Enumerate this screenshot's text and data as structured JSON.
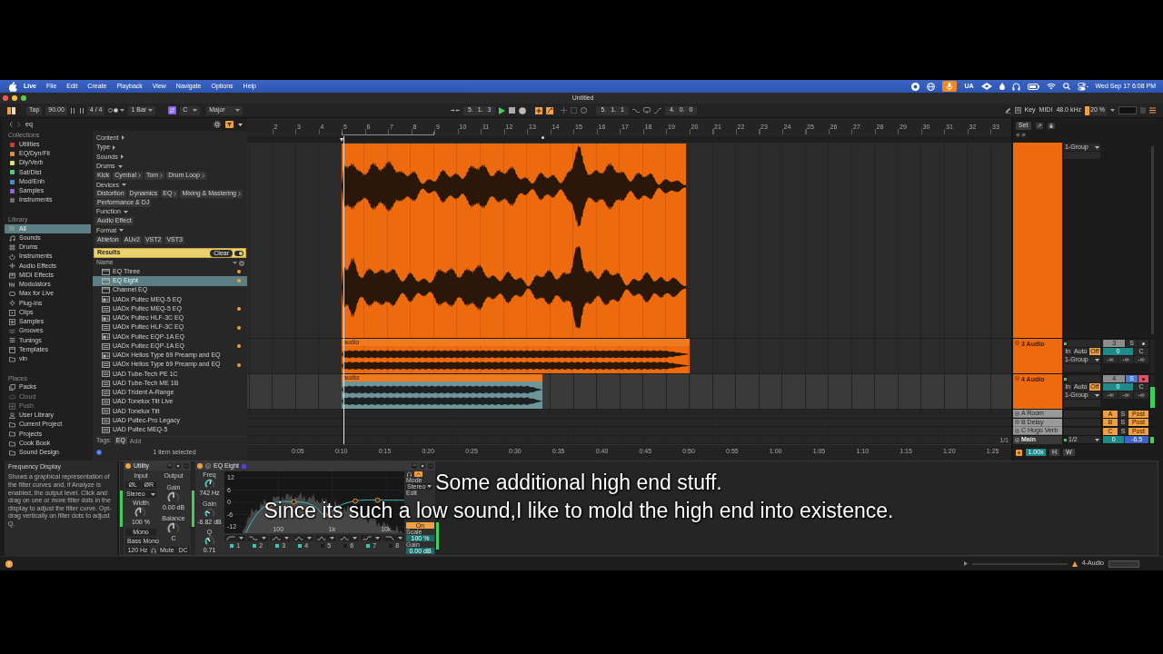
{
  "menu_bar": {
    "app": "Live",
    "items": [
      "File",
      "Edit",
      "Create",
      "Playback",
      "View",
      "Navigate",
      "Options",
      "Help"
    ],
    "status_label": "UA",
    "clock": "Wed Sep 17 6:08 PM"
  },
  "window": {
    "title": "Untitled"
  },
  "toolbar": {
    "tap": "Tap",
    "tempo": "90.00",
    "meter": "4 / 4",
    "quantize": "1 Bar",
    "key": "C",
    "scale": "Major",
    "position": "5. 1. 3",
    "loop_start": "5. 1. 1",
    "loop_length": "4. 0. 0",
    "key_button": "Key",
    "midi_button": "MIDI",
    "sample_rate": "48.0 kHz",
    "cpu": {
      "reading": "20 %",
      "level": 0.2
    }
  },
  "browser": {
    "search": "eq",
    "collections_heading": "Collections",
    "collections": [
      {
        "label": "Utilities",
        "color": "#d63a2f"
      },
      {
        "label": "EQ/Dyn/Fil",
        "color": "#e98a2a"
      },
      {
        "label": "Dly/Verb",
        "color": "#e8e06a"
      },
      {
        "label": "Sat/Dist",
        "color": "#4fd27c"
      },
      {
        "label": "Mod/Enh",
        "color": "#3f8de0"
      },
      {
        "label": "Samples",
        "color": "#9a5be0"
      },
      {
        "label": "Instruments",
        "color": "#6f6f6f"
      }
    ],
    "library_heading": "Library",
    "library": [
      {
        "label": "All",
        "selected": true
      },
      {
        "label": "Sounds",
        "selected": false
      },
      {
        "label": "Drums",
        "selected": false
      },
      {
        "label": "Instruments",
        "selected": false
      },
      {
        "label": "Audio Effects",
        "selected": false
      },
      {
        "label": "MIDI Effects",
        "selected": false
      },
      {
        "label": "Modulators",
        "selected": false
      },
      {
        "label": "Max for Live",
        "selected": false
      },
      {
        "label": "Plug-ins",
        "selected": false
      },
      {
        "label": "Clips",
        "selected": false
      },
      {
        "label": "Samples",
        "selected": false
      },
      {
        "label": "Grooves",
        "selected": false
      },
      {
        "label": "Tunings",
        "selected": false
      },
      {
        "label": "Templates",
        "selected": false
      },
      {
        "label": "vin",
        "selected": false
      }
    ],
    "places_heading": "Places",
    "places": [
      {
        "label": "Packs",
        "disabled": false
      },
      {
        "label": "Cloud",
        "disabled": true
      },
      {
        "label": "Push",
        "disabled": true
      },
      {
        "label": "User Library",
        "disabled": false
      },
      {
        "label": "Current Project",
        "disabled": false
      },
      {
        "label": "Projects",
        "disabled": false
      },
      {
        "label": "Cook Book",
        "disabled": false
      },
      {
        "label": "Sound Design",
        "disabled": false
      }
    ],
    "filters": [
      {
        "label": "Content",
        "expanded": false
      },
      {
        "label": "Type",
        "expanded": false
      },
      {
        "label": "Sounds",
        "expanded": false
      },
      {
        "label": "Drums",
        "expanded": true,
        "tags": [
          {
            "label": "Kick",
            "more": false
          },
          {
            "label": "Cymbal",
            "more": true
          },
          {
            "label": "Tom",
            "more": true
          },
          {
            "label": "Drum Loop",
            "more": true
          }
        ]
      },
      {
        "label": "Devices",
        "expanded": true,
        "tags": [
          {
            "label": "Distortion",
            "more": false
          },
          {
            "label": "Dynamics",
            "more": false
          },
          {
            "label": "EQ",
            "more": true
          },
          {
            "label": "Mixing & Mastering",
            "more": true
          },
          {
            "label": "Performance & DJ",
            "more": false
          }
        ]
      },
      {
        "label": "Function",
        "expanded": true,
        "tags": [
          {
            "label": "Audio Effect",
            "more": false
          }
        ]
      },
      {
        "label": "Format",
        "expanded": true,
        "tags": [
          {
            "label": "Ableton",
            "more": false
          },
          {
            "label": "AUv2",
            "more": false
          },
          {
            "label": "VST2",
            "more": false
          },
          {
            "label": "VST3",
            "more": false
          }
        ]
      }
    ],
    "results": {
      "heading": "Results",
      "clear": "Clear",
      "column": "Name",
      "items": [
        {
          "label": "EQ Three",
          "kind": "device",
          "favorite": true,
          "selected": false
        },
        {
          "label": "EQ Eight",
          "kind": "device",
          "favorite": true,
          "selected": true
        },
        {
          "label": "Channel EQ",
          "kind": "device",
          "favorite": false,
          "selected": false
        },
        {
          "label": "UADx Pultec MEQ-5 EQ",
          "kind": "wrapper",
          "favorite": false,
          "selected": false
        },
        {
          "label": "UADx Pultec MEQ-5 EQ",
          "kind": "plugin",
          "favorite": true,
          "selected": false
        },
        {
          "label": "UADx Pultec HLF-3C EQ",
          "kind": "wrapper",
          "favorite": false,
          "selected": false
        },
        {
          "label": "UADx Pultec HLF-3C EQ",
          "kind": "plugin",
          "favorite": true,
          "selected": false
        },
        {
          "label": "UADx Pultec EQP-1A EQ",
          "kind": "wrapper",
          "favorite": false,
          "selected": false
        },
        {
          "label": "UADx Pultec EQP-1A EQ",
          "kind": "plugin",
          "favorite": true,
          "selected": false
        },
        {
          "label": "UADx Helios Type 69 Preamp and EQ",
          "kind": "wrapper",
          "favorite": false,
          "selected": false
        },
        {
          "label": "UADx Helios Type 69 Preamp and EQ",
          "kind": "plugin",
          "favorite": true,
          "selected": false
        },
        {
          "label": "UAD Tube-Tech PE 1C",
          "kind": "plugin",
          "favorite": false,
          "selected": false
        },
        {
          "label": "UAD Tube-Tech ME 1B",
          "kind": "plugin",
          "favorite": false,
          "selected": false
        },
        {
          "label": "UAD Trident A-Range",
          "kind": "plugin",
          "favorite": false,
          "selected": false
        },
        {
          "label": "UAD Tonelux Tilt Live",
          "kind": "plugin",
          "favorite": false,
          "selected": false
        },
        {
          "label": "UAD Tonelux Tilt",
          "kind": "plugin",
          "favorite": false,
          "selected": false
        },
        {
          "label": "UAD Pultec-Pro Legacy",
          "kind": "plugin",
          "favorite": false,
          "selected": false
        },
        {
          "label": "UAD Pultec MEQ-5",
          "kind": "plugin",
          "favorite": false,
          "selected": false
        }
      ]
    },
    "tags_label": "Tags:",
    "tags": [
      "EQ"
    ],
    "tag_placeholder": "Add",
    "selection": "1 item selected"
  },
  "arrangement": {
    "bars": [
      "2",
      "3",
      "4",
      "5",
      "6",
      "7",
      "8",
      "9",
      "10",
      "11",
      "12",
      "13",
      "14",
      "15",
      "16",
      "17",
      "18",
      "19",
      "20",
      "21",
      "22",
      "23",
      "24",
      "25",
      "26",
      "27",
      "28",
      "29",
      "30",
      "31",
      "32",
      "33"
    ],
    "times": [
      "0:05",
      "0:10",
      "0:15",
      "0:20",
      "0:25",
      "0:30",
      "0:35",
      "0:40",
      "0:45",
      "0:50",
      "0:55",
      "1:00",
      "1:05",
      "1:10",
      "1:15",
      "1:20",
      "1:25"
    ],
    "corner_label": "1/1"
  },
  "tracks": [
    {
      "routing": "1-Group",
      "selected": false,
      "clip": {
        "selected": false
      }
    },
    {
      "name": "3 Audio",
      "number": "3",
      "solo": {
        "label": "S",
        "on": false
      },
      "armed": false,
      "monitor": [
        {
          "label": "In",
          "selected": false
        },
        {
          "label": "Auto",
          "selected": false
        },
        {
          "label": "Off",
          "selected": true
        }
      ],
      "routing": "1-Group",
      "volume": "0",
      "pan": "C",
      "sends": [
        "-∞",
        "-∞",
        "-∞"
      ],
      "meter": {
        "level": 0
      },
      "selected": false,
      "clip": {
        "label": "audio",
        "selected": false
      }
    },
    {
      "name": "4 Audio",
      "number": "4",
      "solo": {
        "label": "S",
        "on": true
      },
      "armed": true,
      "monitor": [
        {
          "label": "In",
          "selected": false
        },
        {
          "label": "Auto",
          "selected": false
        },
        {
          "label": "Off",
          "selected": true
        }
      ],
      "routing": "1-Group",
      "volume": "0",
      "pan": "C",
      "sends": [
        "-∞",
        "-∞",
        "-∞"
      ],
      "meter": {
        "level": 0.65
      },
      "selected": true,
      "clip": {
        "label": "audio",
        "selected": true
      }
    }
  ],
  "returns": [
    {
      "name": "A Room",
      "send": "A",
      "solo": {
        "label": "S",
        "on": false
      },
      "post": {
        "label": "Post",
        "on": true
      }
    },
    {
      "name": "B Delay",
      "send": "B",
      "solo": {
        "label": "S",
        "on": false
      },
      "post": {
        "label": "Post",
        "on": true
      }
    },
    {
      "name": "C Hugo Verb",
      "send": "C",
      "solo": {
        "label": "S",
        "on": false
      },
      "post": {
        "label": "Post",
        "on": true
      }
    }
  ],
  "main": {
    "name": "Main",
    "routing": "1/2",
    "volume": "0",
    "pan": "-6.5"
  },
  "mixer": {
    "set_button": "Set",
    "zoom": "1.00x",
    "h_button": "H",
    "w_button": "W"
  },
  "devices": {
    "info": {
      "title": "Frequency Display",
      "text": "Shows a graphical representation of the filter curves and, if Analyze is enabled, the output level. Click and drag on one or more filter dots in the display to adjust the filter curve. Opt-drag vertically on filter dots to adjust Q."
    },
    "utility": {
      "title": "Utility",
      "on": true,
      "input_label": "Input",
      "output_label": "Output",
      "phase": [
        {
          "label": "ØL",
          "on": false
        },
        {
          "label": "ØR",
          "on": false
        }
      ],
      "channel_mode": "Stereo",
      "width": {
        "label": "Width",
        "value": "100 %",
        "level": 0.5
      },
      "mono": {
        "label": "Mono",
        "on": false
      },
      "bass_mono": {
        "label": "Bass Mono",
        "on": false
      },
      "bass_freq": "120 Hz",
      "gain": {
        "label": "Gain",
        "value": "0.00 dB",
        "level": 0.5
      },
      "balance": {
        "label": "Balance",
        "value": "C",
        "level": 0.5
      },
      "mute": {
        "label": "Mute",
        "on": false
      },
      "dc": {
        "label": "DC",
        "on": false
      }
    },
    "eq_eight": {
      "title": "EQ Eight",
      "on": true,
      "knobs": [
        {
          "label": "Freq",
          "value": "742 Hz",
          "level": 0.56
        },
        {
          "label": "Gain",
          "value": "-6.82 dB",
          "level": 0.27
        },
        {
          "label": "Q",
          "value": "0.71",
          "level": 0.38
        }
      ],
      "y_labels": [
        "12",
        "6",
        "0",
        "-6",
        "-12"
      ],
      "x_labels": [
        "100",
        "1k",
        "10k"
      ],
      "bands": [
        {
          "label": "1",
          "kind": "low-cut",
          "on": true
        },
        {
          "label": "2",
          "kind": "low-shelf",
          "on": true
        },
        {
          "label": "3",
          "kind": "bell",
          "on": true
        },
        {
          "label": "4",
          "kind": "bell",
          "on": true
        },
        {
          "label": "5",
          "kind": "bell",
          "on": false
        },
        {
          "label": "6",
          "kind": "bell",
          "on": false
        },
        {
          "label": "7",
          "kind": "high-shelf",
          "on": true
        },
        {
          "label": "8",
          "kind": "high-cut",
          "on": false
        }
      ],
      "mode_label": "Mode",
      "mode": "Stereo",
      "edit_label": "Edit",
      "toggle": {
        "label": "On",
        "on": true
      },
      "scale": {
        "label": "Scale",
        "value": "100 %"
      },
      "gain": {
        "label": "Gain",
        "value": "0.00 dB"
      }
    }
  },
  "subtitles": [
    "Some additional high end stuff.",
    "Since its such a low sound,I like to mold the high end into existence."
  ],
  "status_bar": {
    "track": "4-Audio"
  }
}
